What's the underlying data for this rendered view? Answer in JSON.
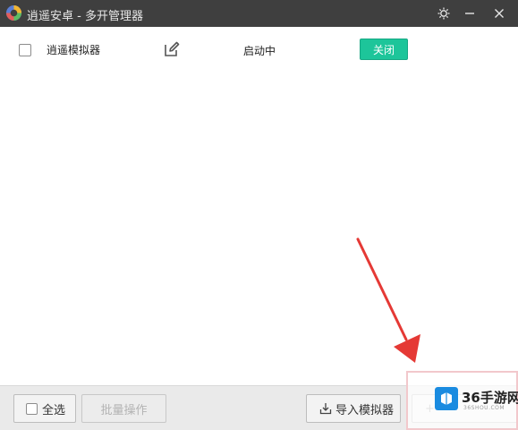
{
  "window": {
    "title": "逍遥安卓 - 多开管理器",
    "icons": {
      "logo": "app-logo-icon",
      "settings": "settings-icon",
      "minimize": "minimize-icon",
      "close": "close-icon"
    }
  },
  "instances": [
    {
      "name": "逍遥模拟器",
      "status": "启动中",
      "action_label": "关闭",
      "checked": false
    }
  ],
  "footer": {
    "select_all_label": "全选",
    "batch_label": "批量操作",
    "import_label": "导入模拟器"
  },
  "watermark": {
    "brand": "36手游网",
    "site": "36SHOU.COM"
  },
  "colors": {
    "titlebar_bg": "#3f3f3f",
    "accent_green": "#1dc59a",
    "arrow_red": "#e53935",
    "footer_bg": "#eaeaea"
  }
}
